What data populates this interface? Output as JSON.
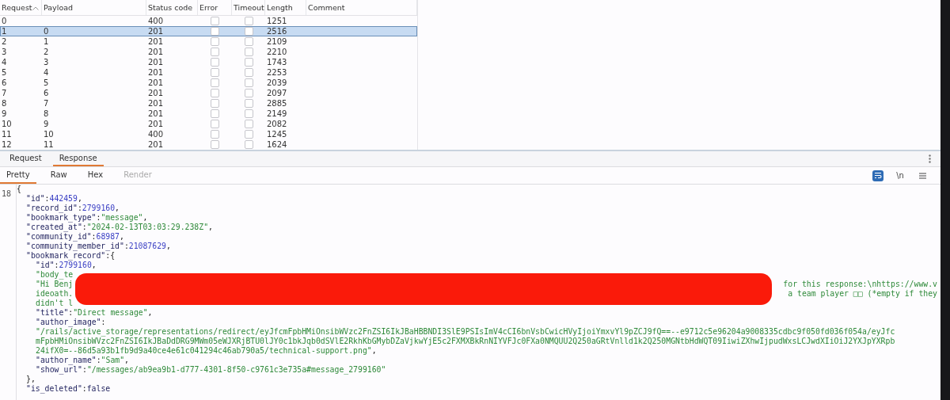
{
  "table": {
    "columns": [
      {
        "label": "Request",
        "sorted": true
      },
      {
        "label": "Payload",
        "sorted": false
      },
      {
        "label": "Status code",
        "sorted": false
      },
      {
        "label": "Error",
        "sorted": false
      },
      {
        "label": "Timeout",
        "sorted": false
      },
      {
        "label": "Length",
        "sorted": false
      },
      {
        "label": "Comment",
        "sorted": false
      }
    ],
    "rows": [
      {
        "request": "0",
        "payload": "",
        "status": "400",
        "error": false,
        "timeout": false,
        "length": "1251",
        "selected": false
      },
      {
        "request": "1",
        "payload": "0",
        "status": "201",
        "error": false,
        "timeout": false,
        "length": "2516",
        "selected": true
      },
      {
        "request": "2",
        "payload": "1",
        "status": "201",
        "error": false,
        "timeout": false,
        "length": "2109",
        "selected": false
      },
      {
        "request": "3",
        "payload": "2",
        "status": "201",
        "error": false,
        "timeout": false,
        "length": "2210",
        "selected": false
      },
      {
        "request": "4",
        "payload": "3",
        "status": "201",
        "error": false,
        "timeout": false,
        "length": "1743",
        "selected": false
      },
      {
        "request": "5",
        "payload": "4",
        "status": "201",
        "error": false,
        "timeout": false,
        "length": "2253",
        "selected": false
      },
      {
        "request": "6",
        "payload": "5",
        "status": "201",
        "error": false,
        "timeout": false,
        "length": "2039",
        "selected": false
      },
      {
        "request": "7",
        "payload": "6",
        "status": "201",
        "error": false,
        "timeout": false,
        "length": "2097",
        "selected": false
      },
      {
        "request": "8",
        "payload": "7",
        "status": "201",
        "error": false,
        "timeout": false,
        "length": "2885",
        "selected": false
      },
      {
        "request": "9",
        "payload": "8",
        "status": "201",
        "error": false,
        "timeout": false,
        "length": "2149",
        "selected": false
      },
      {
        "request": "10",
        "payload": "9",
        "status": "201",
        "error": false,
        "timeout": false,
        "length": "2082",
        "selected": false
      },
      {
        "request": "11",
        "payload": "10",
        "status": "400",
        "error": false,
        "timeout": false,
        "length": "1245",
        "selected": false
      },
      {
        "request": "12",
        "payload": "11",
        "status": "201",
        "error": false,
        "timeout": false,
        "length": "1624",
        "selected": false
      }
    ]
  },
  "message_tabs": [
    {
      "label": "Request",
      "selected": false
    },
    {
      "label": "Response",
      "selected": true
    }
  ],
  "view_tabs": [
    {
      "label": "Pretty",
      "selected": true,
      "disabled": false
    },
    {
      "label": "Raw",
      "selected": false,
      "disabled": false
    },
    {
      "label": "Hex",
      "selected": false,
      "disabled": false
    },
    {
      "label": "Render",
      "selected": false,
      "disabled": true
    }
  ],
  "view_tools": [
    {
      "kind": "wrap",
      "selected": true
    },
    {
      "kind": "text",
      "label": "\\n",
      "selected": false
    },
    {
      "kind": "menu",
      "selected": false
    }
  ],
  "editor": {
    "line_number": "18",
    "lines": [
      {
        "segments": [
          {
            "kind": "punct",
            "text": "{"
          }
        ],
        "children": [
          {
            "segments": [
              {
                "kind": "key",
                "text": "\"id\""
              },
              {
                "kind": "punct",
                "text": ":"
              },
              {
                "kind": "number",
                "text": "442459"
              },
              {
                "kind": "punct",
                "text": ","
              }
            ]
          },
          {
            "segments": [
              {
                "kind": "key",
                "text": "\"record_id\""
              },
              {
                "kind": "punct",
                "text": ":"
              },
              {
                "kind": "number",
                "text": "2799160"
              },
              {
                "kind": "punct",
                "text": ","
              }
            ]
          },
          {
            "segments": [
              {
                "kind": "key",
                "text": "\"bookmark_type\""
              },
              {
                "kind": "punct",
                "text": ":"
              },
              {
                "kind": "string",
                "text": "\"message\""
              },
              {
                "kind": "punct",
                "text": ","
              }
            ]
          },
          {
            "segments": [
              {
                "kind": "key",
                "text": "\"created_at\""
              },
              {
                "kind": "punct",
                "text": ":"
              },
              {
                "kind": "string",
                "text": "\"2024-02-13T03:03:29.238Z\""
              },
              {
                "kind": "punct",
                "text": ","
              }
            ]
          },
          {
            "segments": [
              {
                "kind": "key",
                "text": "\"community_id\""
              },
              {
                "kind": "punct",
                "text": ":"
              },
              {
                "kind": "number",
                "text": "68987"
              },
              {
                "kind": "punct",
                "text": ","
              }
            ]
          },
          {
            "segments": [
              {
                "kind": "key",
                "text": "\"community_member_id\""
              },
              {
                "kind": "punct",
                "text": ":"
              },
              {
                "kind": "number",
                "text": "21087629"
              },
              {
                "kind": "punct",
                "text": ","
              }
            ]
          },
          {
            "segments": [
              {
                "kind": "key",
                "text": "\"bookmark_record\""
              },
              {
                "kind": "punct",
                "text": ":{"
              }
            ],
            "children": [
              {
                "segments": [
                  {
                    "kind": "key",
                    "text": "\"id\""
                  },
                  {
                    "kind": "punct",
                    "text": ":"
                  },
                  {
                    "kind": "number",
                    "text": "2799160"
                  },
                  {
                    "kind": "punct",
                    "text": ","
                  }
                ]
              },
              {
                "kind": "redacted",
                "lines": [
                  {
                    "left": "\"body_te"
                  },
                  {
                    "left": "\"Hi Benj",
                    "right": "for this response:\\nhttps://www.v"
                  },
                  {
                    "left": "ideoath.",
                    "right": "a team player □□ (*empty if they"
                  },
                  {
                    "left": "didn't l"
                  }
                ]
              },
              {
                "segments": [
                  {
                    "kind": "key",
                    "text": "\"title\""
                  },
                  {
                    "kind": "punct",
                    "text": ":"
                  },
                  {
                    "kind": "string",
                    "text": "\"Direct message\""
                  },
                  {
                    "kind": "punct",
                    "text": ","
                  }
                ]
              },
              {
                "segments": [
                  {
                    "kind": "key",
                    "text": "\"author_image\""
                  },
                  {
                    "kind": "punct",
                    "text": ":"
                  }
                ]
              },
              {
                "segments": [
                  {
                    "kind": "string",
                    "text": "\"/rails/active_storage/representations/redirect/eyJfcmFpbHMiOnsibWVzc2FnZSI6IkJBaHBBNDI3SlE9PSIsImV4cCI6bnVsbCwicHVyIjoiYmxvYl9pZCJ9fQ==--e9712c5e96204a9008335cdbc9f050fd036f054a/eyJfc"
                  }
                ]
              },
              {
                "segments": [
                  {
                    "kind": "string",
                    "text": "mFpbHMiOnsibWVzc2FnZSI6IkJBaDdDRG9MWm05eWJXRjBTU0lJY0c1bkJqb0dSVlE2RkhKbGMybDZaVjkwYjE5c2FXMXBkRnNIYVFJc0FXa0NMQUU2Q250aGRtVnlld1k2Q250MGNtbHdWQT09IiwiZXhwIjpudWxsLCJwdXIiOiJ2YXJpYXRpb"
                  }
                ]
              },
              {
                "segments": [
                  {
                    "kind": "string",
                    "text": "24ifX0=--86d5a93b1fb9d9a40ce4e61c041294c46ab790a5/technical-support.png\""
                  },
                  {
                    "kind": "punct",
                    "text": ","
                  }
                ]
              },
              {
                "segments": [
                  {
                    "kind": "key",
                    "text": "\"author_name\""
                  },
                  {
                    "kind": "punct",
                    "text": ":"
                  },
                  {
                    "kind": "string",
                    "text": "\"Sam\""
                  },
                  {
                    "kind": "punct",
                    "text": ","
                  }
                ]
              },
              {
                "segments": [
                  {
                    "kind": "key",
                    "text": "\"show_url\""
                  },
                  {
                    "kind": "punct",
                    "text": ":"
                  },
                  {
                    "kind": "string",
                    "text": "\"/messages/ab9ea9b1-d777-4301-8f50-c9761c3e735a#message_2799160\""
                  }
                ]
              }
            ]
          },
          {
            "segments": [
              {
                "kind": "punct",
                "text": "},"
              }
            ]
          },
          {
            "segments": [
              {
                "kind": "key",
                "text": "\"is_deleted\""
              },
              {
                "kind": "punct",
                "text": ":"
              },
              {
                "kind": "literal",
                "text": "false"
              }
            ]
          }
        ]
      }
    ]
  }
}
